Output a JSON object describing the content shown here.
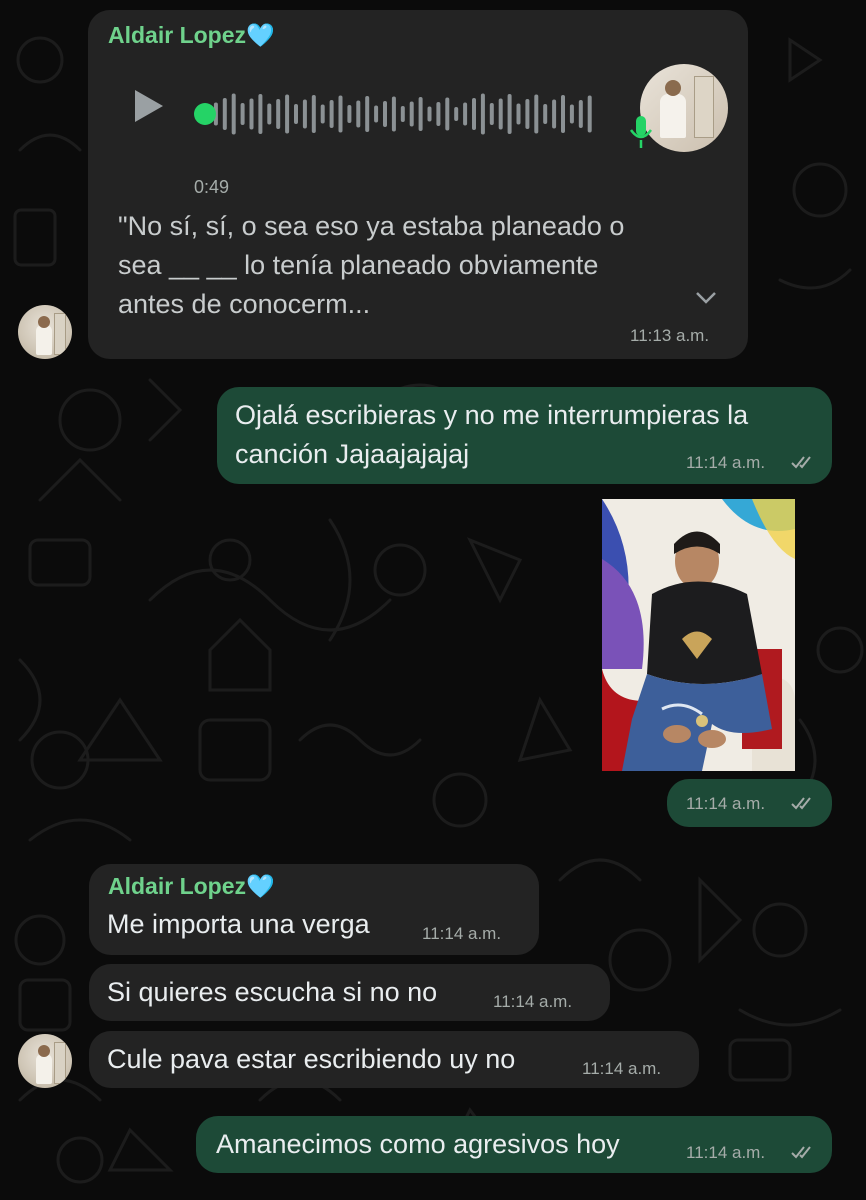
{
  "contact": {
    "name": "Aldair Lopez",
    "heart": "🩵"
  },
  "voice_note": {
    "duration": "0:49",
    "transcript": [
      "\"No sí, sí, o sea eso ya estaba planeado o",
      "sea __ __ lo tenía planeado obviamente",
      "antes de conocerm..."
    ],
    "time": "11:13 a.m."
  },
  "out1": {
    "lines": [
      "Ojalá escribieras y no me interrumpieras la",
      "canción Jajaajajajaj"
    ],
    "time": "11:14 a.m."
  },
  "photo_msg": {
    "time": "11:14 a.m."
  },
  "in_group": [
    {
      "text": "Me importa una verga",
      "time": "11:14 a.m."
    },
    {
      "text": "Si quieres escucha si no no",
      "time": "11:14 a.m."
    },
    {
      "text": "Cule pava estar escribiendo uy no",
      "time": "11:14 a.m."
    }
  ],
  "out2": {
    "text": "Amanecimos como agresivos hoy",
    "time": "11:14 a.m."
  },
  "colors": {
    "incoming_bubble": "#232323",
    "outgoing_bubble": "#1d4a37",
    "sender_name": "#6fd28c",
    "read_ticks": "#a5aca9"
  }
}
